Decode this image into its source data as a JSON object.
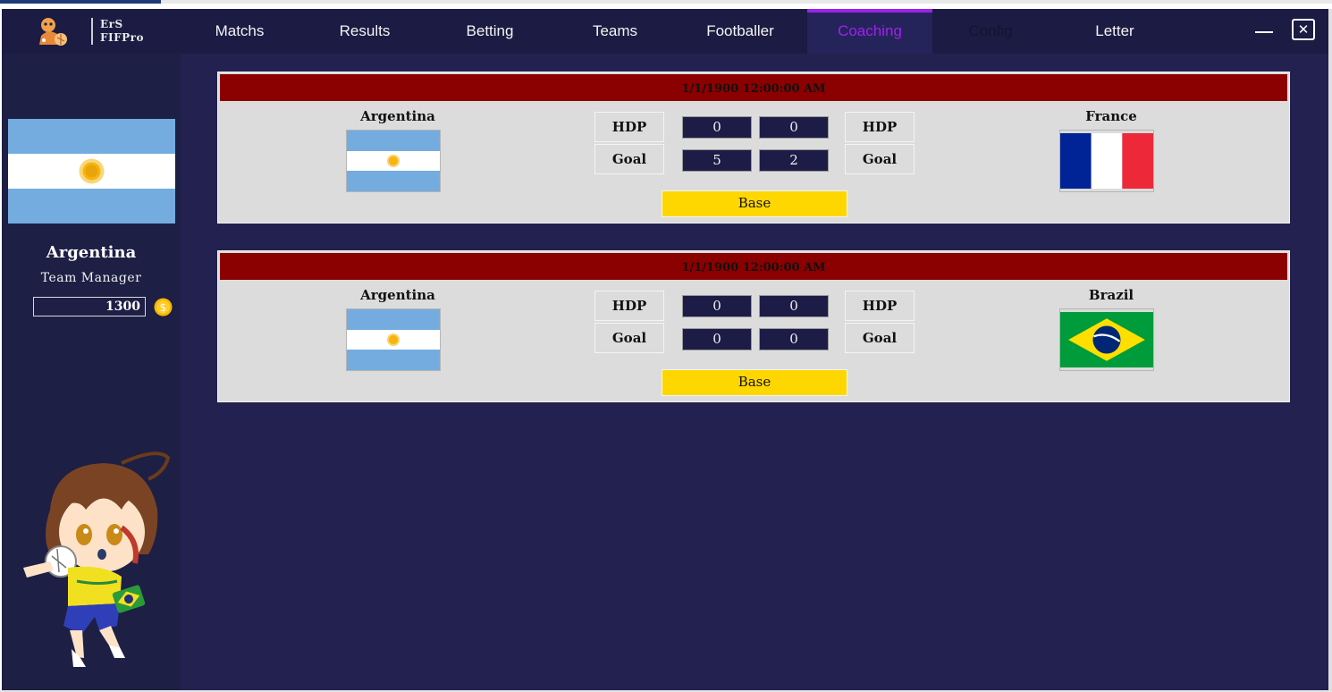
{
  "app": {
    "logo_line1": "ErS",
    "logo_line2": "FIFPro"
  },
  "nav": {
    "tabs": [
      {
        "label": "Matchs"
      },
      {
        "label": "Results"
      },
      {
        "label": "Betting"
      },
      {
        "label": "Teams"
      },
      {
        "label": "Footballer"
      },
      {
        "label": "Coaching",
        "active": true
      },
      {
        "label": "Config"
      },
      {
        "label": "Letter"
      }
    ]
  },
  "window_controls": {
    "close_glyph": "✕"
  },
  "sidebar": {
    "team_name": "Argentina",
    "role": "Team Manager",
    "balance": "1300",
    "coin_glyph": "$"
  },
  "matches": [
    {
      "datetime": "1/1/1900 12:00:00 AM",
      "home": {
        "name": "Argentina",
        "flag": "argentina-flag"
      },
      "away": {
        "name": "France",
        "flag": "france-flag"
      },
      "hdp_label": "HDP",
      "goal_label": "Goal",
      "hdp_home": "0",
      "hdp_away": "0",
      "goal_home": "5",
      "goal_away": "2",
      "button": "Base"
    },
    {
      "datetime": "1/1/1900 12:00:00 AM",
      "home": {
        "name": "Argentina",
        "flag": "argentina-flag"
      },
      "away": {
        "name": "Brazil",
        "flag": "brazil-flag"
      },
      "hdp_label": "HDP",
      "goal_label": "Goal",
      "hdp_home": "0",
      "hdp_away": "0",
      "goal_home": "0",
      "goal_away": "0",
      "button": "Base"
    }
  ],
  "colors": {
    "background": "#222150",
    "topbar": "#1b1b43",
    "sidebar": "#1d1f45",
    "active_tab": "#a020f0",
    "card_header": "#8b0000",
    "base_button": "#ffd700",
    "card": "#dcdcdc"
  }
}
